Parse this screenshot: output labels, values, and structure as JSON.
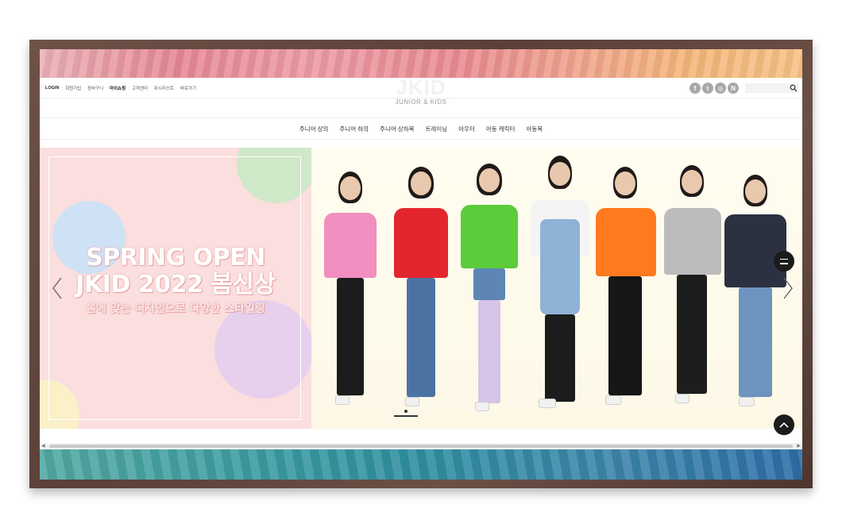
{
  "util_nav": [
    "LOGIN",
    "회원가입",
    "장바구니",
    "마이쇼핑",
    "고객센터",
    "위시리스트",
    "바로가기"
  ],
  "logo": {
    "main": "JKID",
    "sub": "JUNIOR & KIDS"
  },
  "social_icons": [
    {
      "name": "facebook-icon",
      "glyph": "f"
    },
    {
      "name": "twitter-icon",
      "glyph": "t"
    },
    {
      "name": "instagram-icon",
      "glyph": "◎"
    },
    {
      "name": "naver-blog-icon",
      "glyph": "N"
    }
  ],
  "search": {
    "placeholder": ""
  },
  "gnb": [
    "주니어 상의",
    "주니어 하의",
    "주니어 상하복",
    "트레이닝",
    "아우터",
    "아동 캐릭터",
    "아동복"
  ],
  "hero": {
    "line1": "SPRING OPEN",
    "line2": "JKID 2022 봄신상",
    "line3": "봄에 맞는 디자인으로 다양한 스타일링"
  },
  "colors": {
    "accent_pink": "#fbdede",
    "watercolor_top": "#e88a92",
    "watercolor_bottom": "#2f8fa1",
    "frame": "#5a4038"
  }
}
